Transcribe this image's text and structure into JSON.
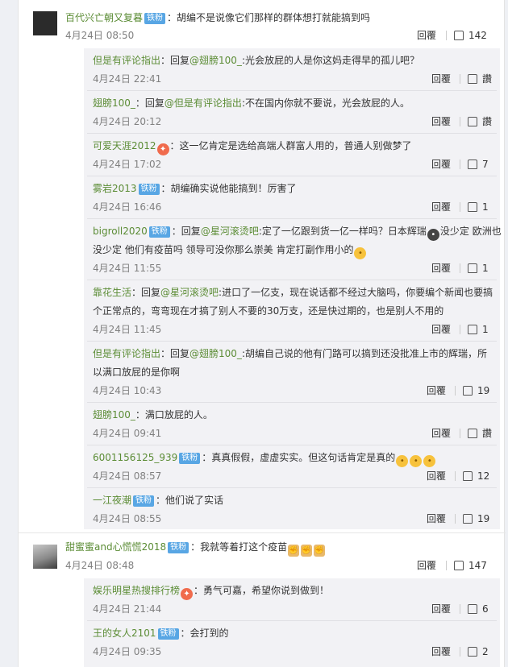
{
  "comments": [
    {
      "user": "百代兴亡朝又复暮",
      "badge": "铁粉",
      "text": "：胡编不是说像它们那样的群体想打就能搞到吗",
      "time": "4月24日 08:50",
      "reply": "回覆",
      "likes": "142",
      "replies": [
        {
          "user": "但是有评论指出",
          "prefix": "：回复",
          "mention": "@翅膀100_",
          "text": ":光会放屁的人是你这妈走得早的孤儿吧？",
          "time": "4月24日 22:41",
          "reply": "回覆",
          "likes": "讚"
        },
        {
          "user": "翅膀100_",
          "prefix": "：回复",
          "mention": "@但是有评论指出",
          "text": ":不在国内你就不要说，光会放屁的人。",
          "time": "4月24日 20:12",
          "reply": "回覆",
          "likes": "讚"
        },
        {
          "user": "可爱天涯2012",
          "text": "：这一亿肯定是选给高端人群富人用的，普通人别做梦了",
          "time": "4月24日 17:02",
          "reply": "回覆",
          "likes": "7"
        },
        {
          "user": "雾岩2013",
          "badge": "铁粉",
          "text": "：胡编确实说他能搞到！厉害了",
          "time": "4月24日 16:46",
          "reply": "回覆",
          "likes": "1"
        },
        {
          "user": "bigroll2020",
          "badge": "铁粉",
          "prefix": "：回复",
          "mention": "@星河滚烫吧",
          "text_a": ":定了一亿跟到货一亿一样吗？日本辉瑞",
          "text_b": "没少定 欧洲也",
          "line2": "没少定 他们有疫苗吗 领导可没你那么崇美 肯定打副作用小的",
          "time": "4月24日 11:55",
          "reply": "回覆",
          "likes": "1"
        },
        {
          "user": "靠花生活",
          "prefix": "：回复",
          "mention": "@星河滚烫吧",
          "text": ":进口了一亿支，现在说话都不经过大脑吗，你要编个新闻也要搞",
          "line2": "个正常点的，弯弯现在才搞了别人不要的30万支，还是快过期的，也是别人不用的",
          "time": "4月24日 11:45",
          "reply": "回覆",
          "likes": "1"
        },
        {
          "user": "但是有评论指出",
          "prefix": "：回复",
          "mention": "@翅膀100_",
          "text": ":胡编自己说的他有门路可以搞到还没批准上市的辉瑞，所",
          "line2": "以满口放屁的是你啊",
          "time": "4月24日 10:43",
          "reply": "回覆",
          "likes": "19"
        },
        {
          "user": "翅膀100_",
          "text": "：满口放屁的人。",
          "time": "4月24日 09:41",
          "reply": "回覆",
          "likes": "讚"
        },
        {
          "user": "6001156125_939",
          "badge": "铁粉",
          "text": "：真真假假，虚虚实实。但这句话肯定是真的",
          "time": "4月24日 08:57",
          "reply": "回覆",
          "likes": "12"
        },
        {
          "user": "一江夜潮",
          "badge": "铁粉",
          "text": "：他们说了实话",
          "time": "4月24日 08:55",
          "reply": "回覆",
          "likes": "19"
        }
      ]
    },
    {
      "user": "甜蜜蜜and心慌慌2018",
      "badge": "铁粉",
      "text": "：我就等着打这个疫苗",
      "time": "4月24日 08:48",
      "reply": "回覆",
      "likes": "147",
      "replies": [
        {
          "user": "娱乐明星热搜排行榜",
          "text": "：勇气可嘉，希望你说到做到！",
          "time": "4月24日 21:44",
          "reply": "回覆",
          "likes": "6"
        },
        {
          "user": "王的女人2101",
          "badge": "铁粉",
          "text": "：会打到的",
          "time": "4月24日 09:35",
          "reply": "回覆",
          "likes": "2"
        }
      ]
    }
  ],
  "icons": [
    "thumb-up-icon",
    "emoji-icon",
    "avatar"
  ]
}
